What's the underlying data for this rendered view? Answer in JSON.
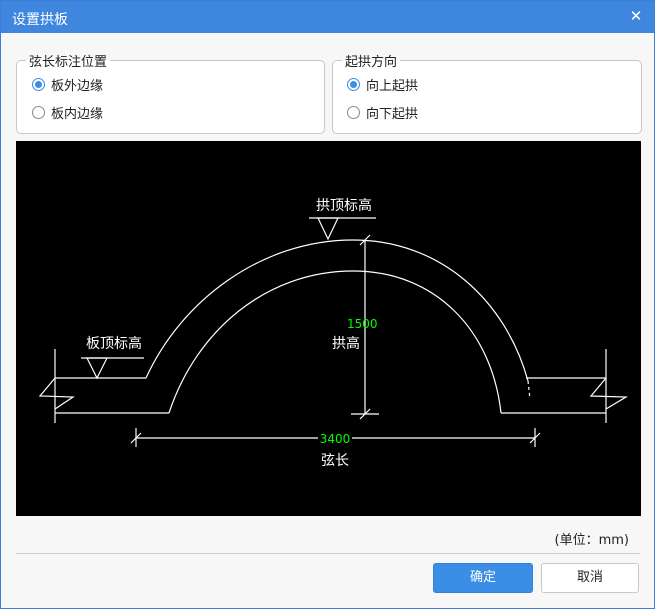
{
  "window": {
    "title": "设置拱板",
    "close_label": "✕"
  },
  "chord_group": {
    "legend": "弦长标注位置",
    "options": [
      {
        "label": "板外边缘",
        "checked": true
      },
      {
        "label": "板内边缘",
        "checked": false
      }
    ]
  },
  "arch_group": {
    "legend": "起拱方向",
    "options": [
      {
        "label": "向上起拱",
        "checked": true
      },
      {
        "label": "向下起拱",
        "checked": false
      }
    ]
  },
  "diagram": {
    "arch_top_label": "拱顶标高",
    "slab_top_label": "板顶标高",
    "arch_height_value": "1500",
    "arch_height_label": "拱高",
    "chord_value": "3400",
    "chord_label": "弦长",
    "line_color": "#ffffff",
    "dim_color": "#00ff00"
  },
  "unit_label": "(单位：mm)",
  "buttons": {
    "ok": "确定",
    "cancel": "取消"
  },
  "colors": {
    "accent": "#3a8ee6",
    "titlebar": "#3f86df"
  }
}
